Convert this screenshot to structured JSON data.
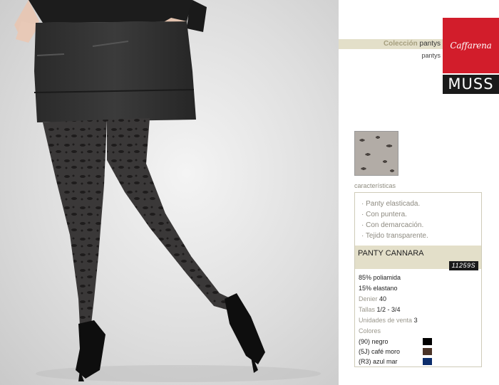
{
  "collection": {
    "prefix": "Colección",
    "suffix": "pantys",
    "subtitle": "pantys"
  },
  "brands": {
    "caffarena": "Caffarena",
    "muss": "MUSS",
    "caffarena_color": "#d21d2b",
    "muss_color": "#1a1a1a"
  },
  "features_label": "características",
  "features": [
    "· Panty elasticada.",
    "· Con puntera.",
    "· Con demarcación.",
    "· Tejido transparente."
  ],
  "product": {
    "name": "PANTY CANNARA",
    "code": "11259S"
  },
  "specs": {
    "composition_1": "85% poliamida",
    "composition_2": "15% elastano",
    "denier_label": "Denier",
    "denier_value": "40",
    "sizes_label": "Tallas",
    "sizes_value": "1/2 - 3/4",
    "units_label": "Unidades de venta",
    "units_value": "3",
    "colors_label": "Colores"
  },
  "colors": [
    {
      "label": "(90) negro",
      "hex": "#000000"
    },
    {
      "label": "(5J) café moro",
      "hex": "#4a3327"
    },
    {
      "label": "(R3) azul mar",
      "hex": "#0c2d6b"
    }
  ]
}
